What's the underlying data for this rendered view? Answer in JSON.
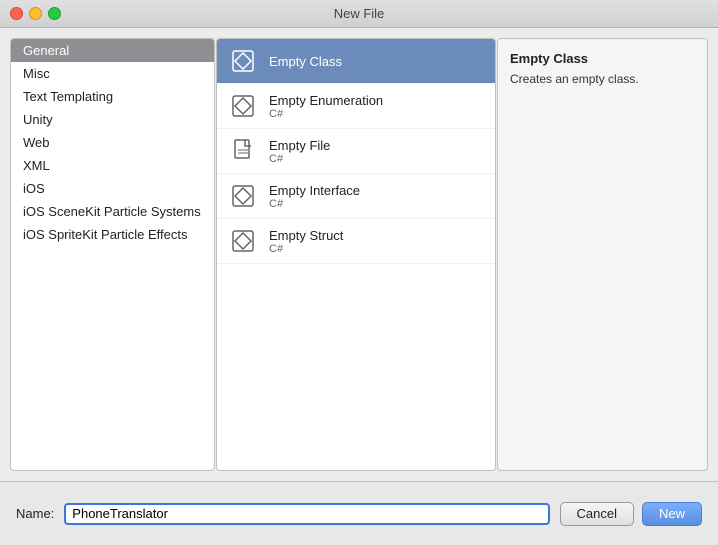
{
  "titleBar": {
    "title": "New File"
  },
  "sidebar": {
    "heading": "General",
    "items": [
      {
        "id": "misc",
        "label": "Misc",
        "selected": false
      },
      {
        "id": "text-templating",
        "label": "Text Templating",
        "selected": false
      },
      {
        "id": "unity",
        "label": "Unity",
        "selected": false
      },
      {
        "id": "web",
        "label": "Web",
        "selected": false
      },
      {
        "id": "xml",
        "label": "XML",
        "selected": false
      },
      {
        "id": "ios",
        "label": "iOS",
        "selected": false
      },
      {
        "id": "ios-scenekit",
        "label": "iOS SceneKit Particle Systems",
        "selected": false
      },
      {
        "id": "ios-spritekit",
        "label": "iOS SpriteKit Particle Effects",
        "selected": false
      }
    ]
  },
  "templates": {
    "items": [
      {
        "id": "empty-class",
        "title": "Empty Class",
        "subtitle": "",
        "selected": true,
        "iconType": "diamond"
      },
      {
        "id": "empty-enumeration",
        "title": "Empty Enumeration",
        "subtitle": "C#",
        "selected": false,
        "iconType": "diamond"
      },
      {
        "id": "empty-file",
        "title": "Empty File",
        "subtitle": "C#",
        "selected": false,
        "iconType": "doc"
      },
      {
        "id": "empty-interface",
        "title": "Empty Interface",
        "subtitle": "C#",
        "selected": false,
        "iconType": "diamond"
      },
      {
        "id": "empty-struct",
        "title": "Empty Struct",
        "subtitle": "C#",
        "selected": false,
        "iconType": "diamond"
      }
    ]
  },
  "detail": {
    "title": "Empty Class",
    "description": "Creates an empty class."
  },
  "nameField": {
    "label": "Name:",
    "value": "PhoneTranslator",
    "placeholder": ""
  },
  "buttons": {
    "cancel": "Cancel",
    "new": "New"
  }
}
